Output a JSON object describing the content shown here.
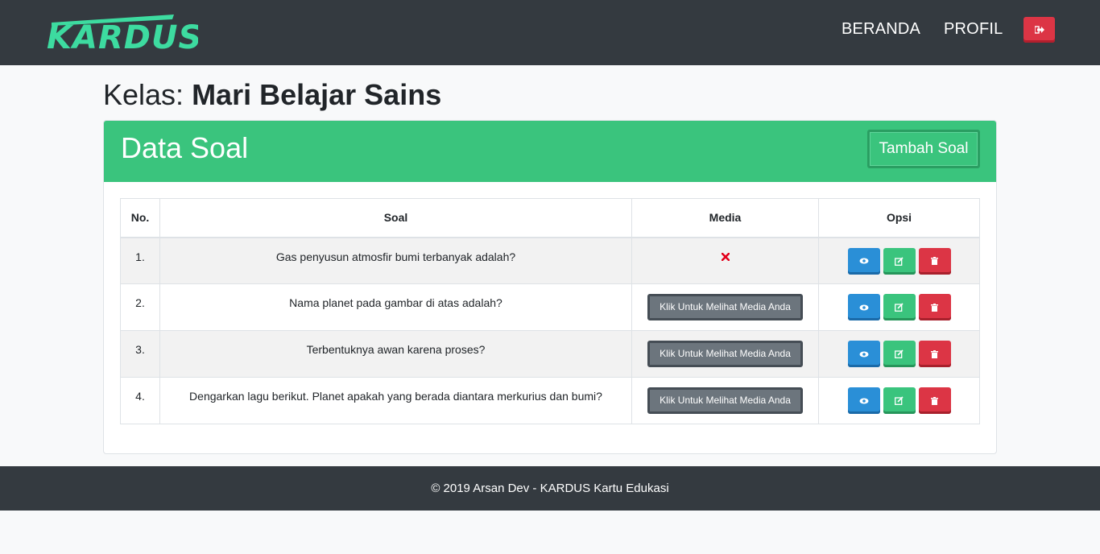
{
  "navbar": {
    "brand": "KARDUS!",
    "brand_color": "#3ddba0",
    "links": [
      {
        "label": "BERANDA"
      },
      {
        "label": "PROFIL"
      }
    ],
    "logout_icon": "sign-out-icon"
  },
  "page": {
    "kelas_label": "Kelas: ",
    "kelas_name": "Mari Belajar Sains"
  },
  "card": {
    "title": "Data Soal",
    "add_button": "Tambah Soal",
    "header_color": "#3ac47d"
  },
  "table": {
    "headers": [
      "No.",
      "Soal",
      "Media",
      "Opsi"
    ],
    "rows": [
      {
        "no": "1.",
        "soal": "Gas penyusun atmosfir bumi terbanyak adalah?",
        "media": null,
        "media_icon": "x-icon"
      },
      {
        "no": "2.",
        "soal": "Nama planet pada gambar di atas adalah?",
        "media": "Klik Untuk Melihat Media Anda"
      },
      {
        "no": "3.",
        "soal": "Terbentuknya awan karena proses?",
        "media": "Klik Untuk Melihat Media Anda"
      },
      {
        "no": "4.",
        "soal": "Dengarkan lagu berikut. Planet apakah yang berada diantara merkurius dan bumi?",
        "media": "Klik Untuk Melihat Media Anda"
      }
    ],
    "action_icons": [
      "eye-icon",
      "edit-icon",
      "trash-icon"
    ]
  },
  "footer": {
    "text": "© 2019 Arsan Dev - KARDUS Kartu Edukasi"
  }
}
